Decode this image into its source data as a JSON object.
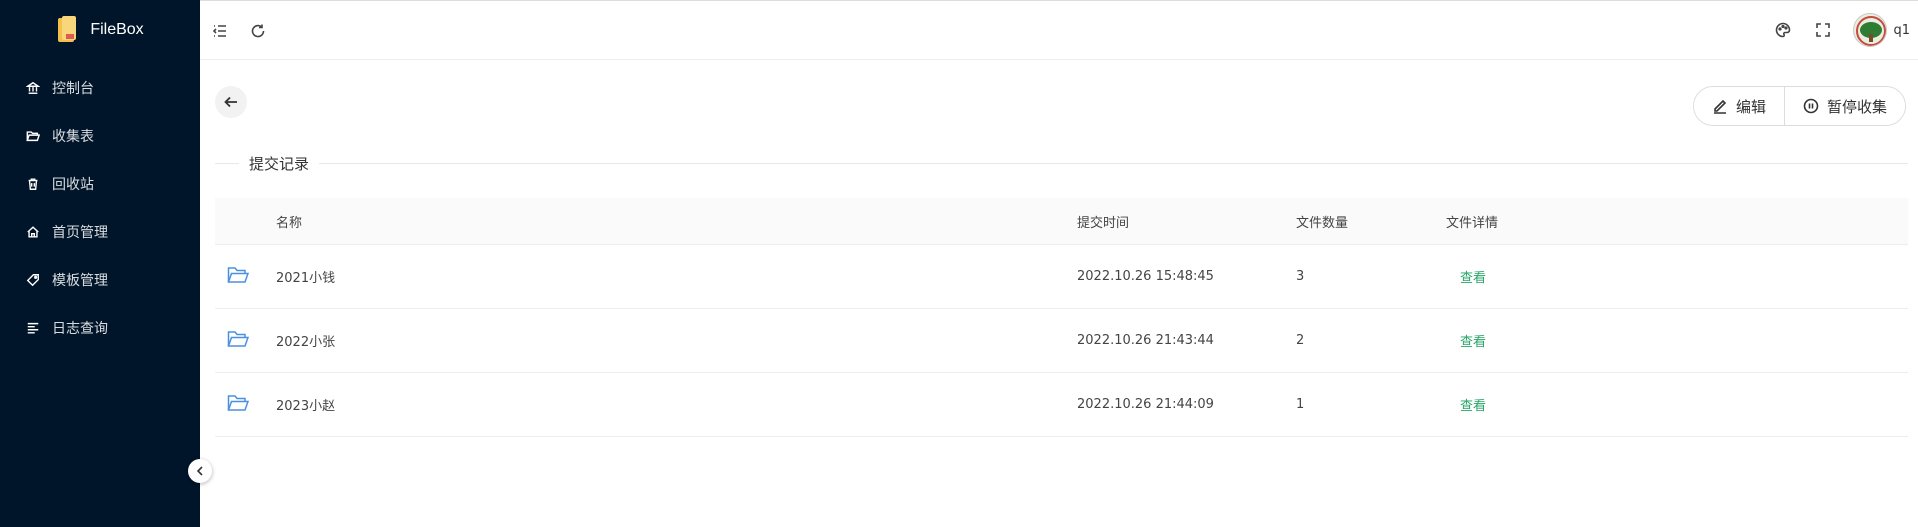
{
  "brand": {
    "title": "FileBox"
  },
  "menu": [
    {
      "label": "控制台",
      "icon": "bank-icon"
    },
    {
      "label": "收集表",
      "icon": "folder-open-icon"
    },
    {
      "label": "回收站",
      "icon": "trash-icon"
    },
    {
      "label": "首页管理",
      "icon": "home-icon"
    },
    {
      "label": "模板管理",
      "icon": "tag-icon"
    },
    {
      "label": "日志查询",
      "icon": "align-left-icon"
    }
  ],
  "header": {
    "username": "q1"
  },
  "toolbar": {
    "edit_label": "编辑",
    "pause_label": "暂停收集"
  },
  "section": {
    "title": "提交记录"
  },
  "table": {
    "columns": [
      "名称",
      "提交时间",
      "文件数量",
      "文件详情"
    ],
    "rows": [
      {
        "name": "2021小钱",
        "time": "2022.10.26 15:48:45",
        "count": "3",
        "action": "查看"
      },
      {
        "name": "2022小张",
        "time": "2022.10.26 21:43:44",
        "count": "2",
        "action": "查看"
      },
      {
        "name": "2023小赵",
        "time": "2022.10.26 21:44:09",
        "count": "1",
        "action": "查看"
      }
    ]
  }
}
